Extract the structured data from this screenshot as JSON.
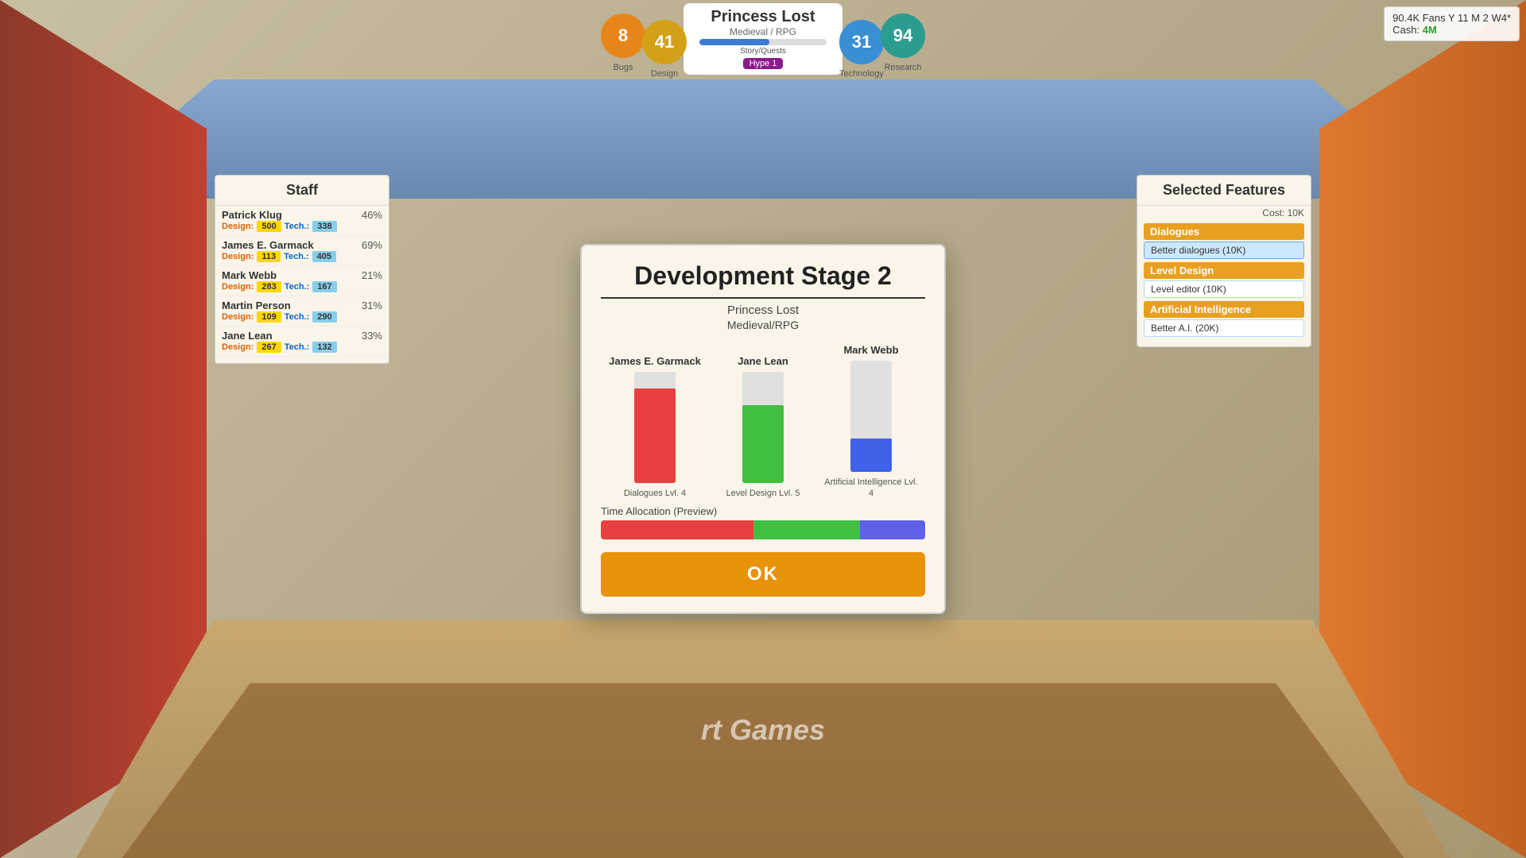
{
  "top_hud": {
    "bugs_label": "Bugs",
    "bugs_value": "8",
    "design_value": "41",
    "design_label": "Design",
    "game_title": "Princess Lost",
    "game_genre": "Medieval / RPG",
    "progress_label": "Story/Quests",
    "progress_pct": 55,
    "hype_label": "Hype 1",
    "technology_value": "31",
    "technology_label": "Technology",
    "research_value": "94",
    "research_label": "Research"
  },
  "top_right": {
    "fans": "90.4K Fans Y 11 M 2 W4*",
    "cash_label": "Cash:",
    "cash_value": "4M"
  },
  "staff_panel": {
    "title": "Staff",
    "members": [
      {
        "name": "Patrick Klug",
        "pct": "46%",
        "design_label": "Design:",
        "design_value": "500",
        "tech_label": "Tech.:",
        "tech_value": "338"
      },
      {
        "name": "James E. Garmack",
        "pct": "69%",
        "design_label": "Design:",
        "design_value": "113",
        "tech_label": "Tech.:",
        "tech_value": "405"
      },
      {
        "name": "Mark Webb",
        "pct": "21%",
        "design_label": "Design:",
        "design_value": "283",
        "tech_label": "Tech.:",
        "tech_value": "167"
      },
      {
        "name": "Martin Person",
        "pct": "31%",
        "design_label": "Design:",
        "design_value": "109",
        "tech_label": "Tech.:",
        "tech_value": "290"
      },
      {
        "name": "Jane Lean",
        "pct": "33%",
        "design_label": "Design:",
        "design_value": "267",
        "tech_label": "Tech.:",
        "tech_value": "132"
      }
    ]
  },
  "features_panel": {
    "title": "Selected Features",
    "cost_label": "Cost: 10K",
    "categories": [
      {
        "name": "Dialogues",
        "items": [
          {
            "label": "Better dialogues (10K)",
            "selected": true
          }
        ]
      },
      {
        "name": "Level Design",
        "items": [
          {
            "label": "Level editor (10K)",
            "selected": false
          }
        ]
      },
      {
        "name": "Artificial Intelligence",
        "items": [
          {
            "label": "Better A.I. (20K)",
            "selected": false
          }
        ]
      }
    ]
  },
  "modal": {
    "title": "Development Stage 2",
    "game_title": "Princess Lost",
    "game_genre": "Medieval/RPG",
    "staff_columns": [
      {
        "name": "James E. Garmack",
        "bar_color": "red",
        "bar_height_pct": 85,
        "feature_label": "Dialogues Lvl. 4"
      },
      {
        "name": "Jane Lean",
        "bar_color": "green",
        "bar_height_pct": 70,
        "feature_label": "Level Design Lvl. 5"
      },
      {
        "name": "Mark Webb",
        "bar_color": "blue",
        "bar_height_pct": 30,
        "feature_label": "Artificial Intelligence Lvl. 4"
      }
    ],
    "time_allocation_label": "Time Allocation (Preview)",
    "time_segments": [
      {
        "color": "#e84040",
        "pct": 47
      },
      {
        "color": "#40c040",
        "pct": 33
      },
      {
        "color": "#6060e8",
        "pct": 20
      }
    ],
    "ok_label": "OK"
  },
  "company_name": "rt Games"
}
